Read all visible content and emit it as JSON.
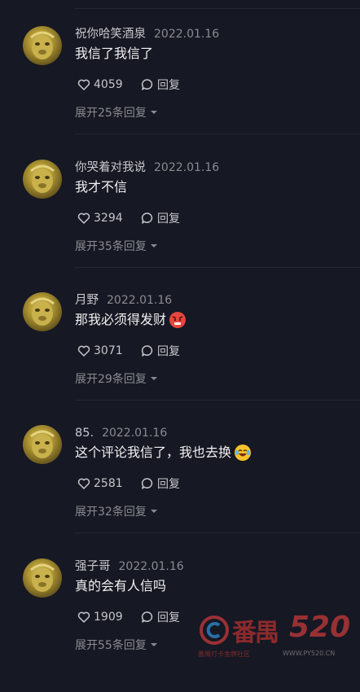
{
  "comments": [
    {
      "username": "祝你哈笑酒泉",
      "date": "2022.01.16",
      "text": "我信了我信了",
      "emoji": "",
      "likes": "4059",
      "reply_label": "回复",
      "expand_label": "展开25条回复"
    },
    {
      "username": "你哭着对我说",
      "date": "2022.01.16",
      "text": "我才不信",
      "emoji": "",
      "likes": "3294",
      "reply_label": "回复",
      "expand_label": "展开35条回复"
    },
    {
      "username": "月野",
      "date": "2022.01.16",
      "text": "那我必须得发财",
      "emoji": "angry-face",
      "likes": "3071",
      "reply_label": "回复",
      "expand_label": "展开29条回复"
    },
    {
      "username": "85.",
      "date": "2022.01.16",
      "text": "这个评论我信了，我也去换",
      "emoji": "laughing-crying-face",
      "likes": "2581",
      "reply_label": "回复",
      "expand_label": "展开32条回复"
    },
    {
      "username": "强子哥",
      "date": "2022.01.16",
      "text": "真的会有人信吗",
      "emoji": "",
      "likes": "1909",
      "reply_label": "回复",
      "expand_label": "展开55条回复"
    }
  ],
  "watermark": {
    "text": "番禺",
    "number": "520",
    "subtitle": "番禺打卡金牌社区",
    "url": "WWW.PY520.CN"
  },
  "colors": {
    "background": "#161823",
    "username": "#c8c9cc",
    "muted": "#8a8b91",
    "text": "#f1f1f2"
  }
}
